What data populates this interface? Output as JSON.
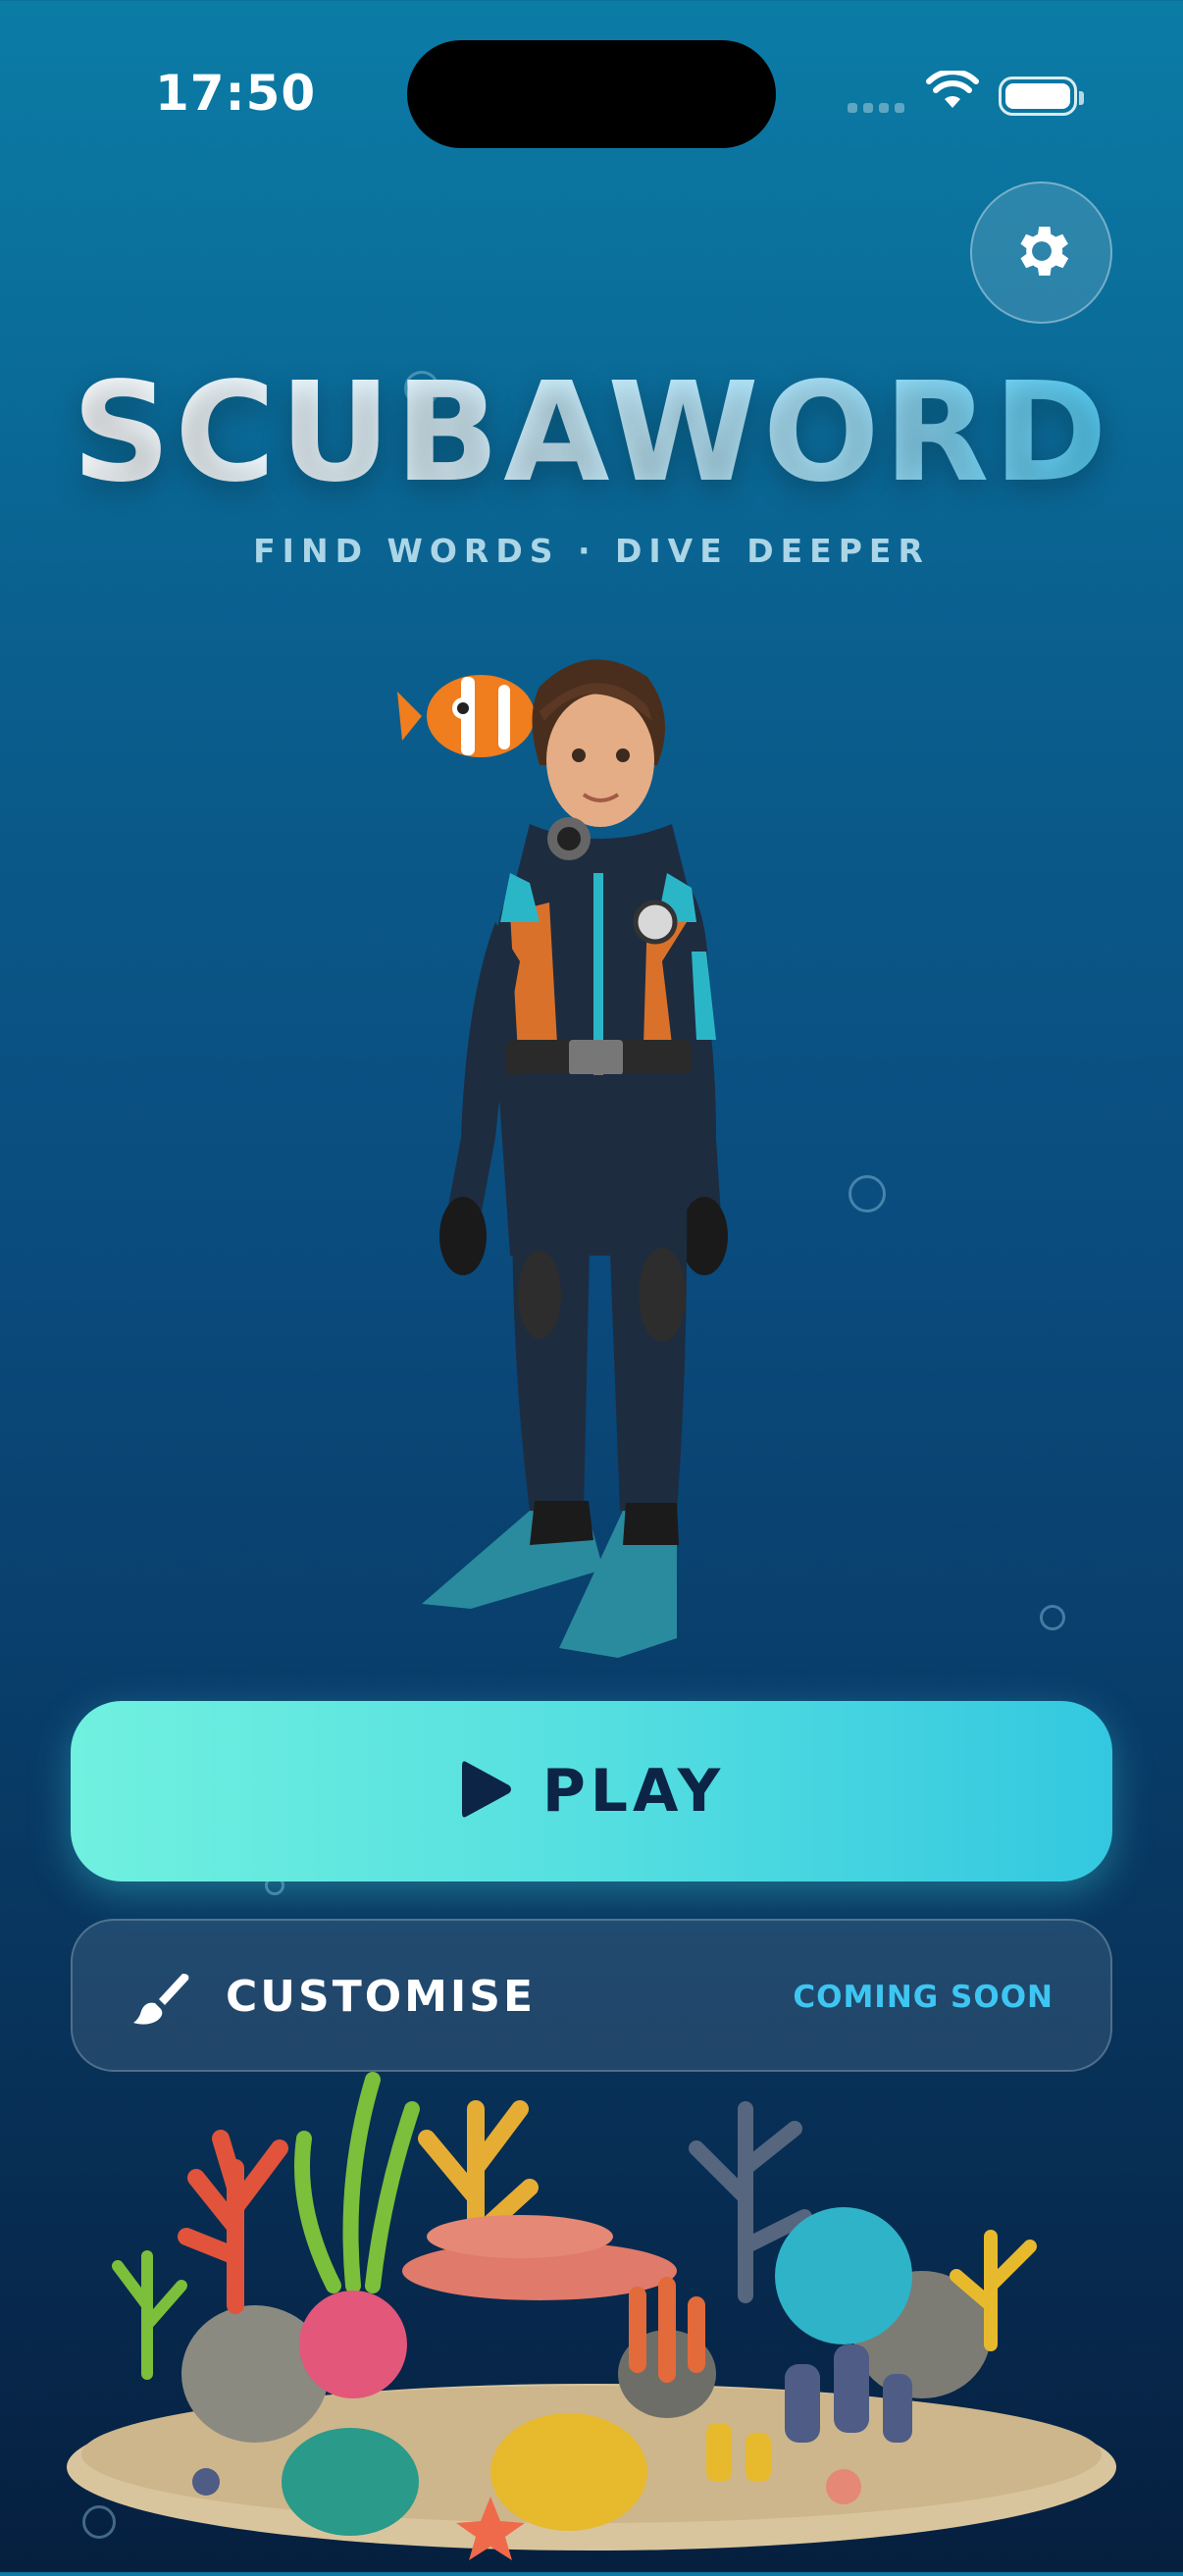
{
  "status_bar": {
    "time": "17:50"
  },
  "app": {
    "title": "SCUBAWORD",
    "tagline": "FIND WORDS · DIVE DEEPER"
  },
  "icons": {
    "settings": "gear-icon",
    "play": "play-icon",
    "customise": "paintbrush-icon",
    "wifi": "wifi-icon",
    "battery": "battery-icon"
  },
  "actions": {
    "play_label": "PLAY",
    "customise_label": "CUSTOMISE",
    "customise_badge": "COMING SOON"
  },
  "colors": {
    "accent": "#3ec6f2",
    "play_gradient_start": "#70f0df",
    "play_gradient_end": "#33c8e0",
    "play_text": "#0c2446",
    "background_top": "#0b7ca6",
    "background_bottom": "#061f3f"
  }
}
